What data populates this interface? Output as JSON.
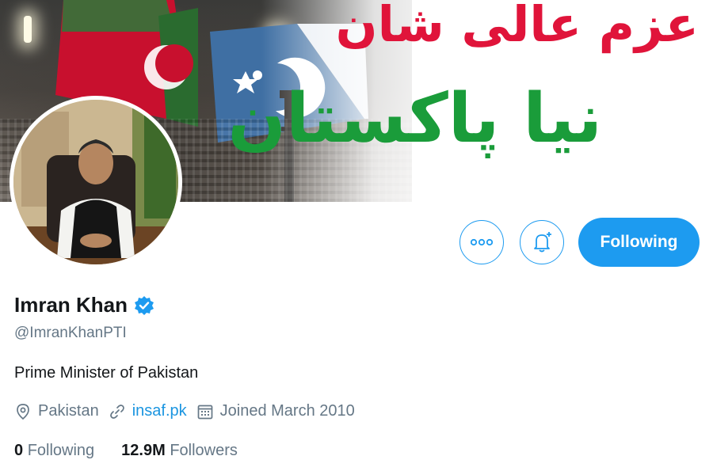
{
  "banner": {
    "urdu_line_1": "عزم عالی شان",
    "urdu_line_2": "نیا پاکستان"
  },
  "profile": {
    "name": "Imran Khan",
    "handle": "@ImranKhanPTI",
    "bio": "Prime Minister of Pakistan",
    "location": "Pakistan",
    "website": "insaf.pk",
    "joined": "Joined March 2010",
    "verified": true
  },
  "actions": {
    "more_icon": "more-horizontal-icon",
    "notify_icon": "bell-plus-icon",
    "follow_label": "Following"
  },
  "stats": {
    "following_count": "0",
    "following_label": "Following",
    "followers_count": "12.9M",
    "followers_label": "Followers"
  },
  "colors": {
    "accent": "#1d9bf0",
    "urdu_red": "#e0143a",
    "urdu_green": "#1a9c3a"
  }
}
